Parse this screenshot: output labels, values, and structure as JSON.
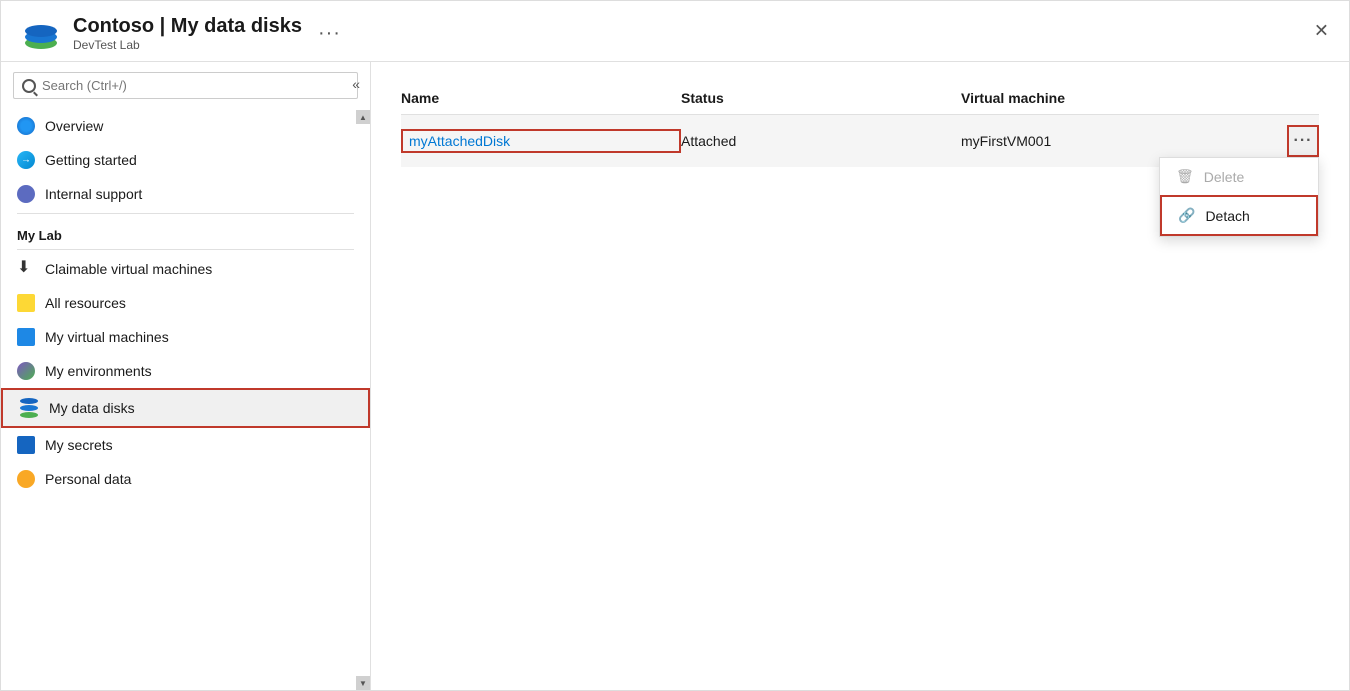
{
  "header": {
    "title": "Contoso | My data disks",
    "subtitle": "DevTest Lab",
    "dots_label": "···",
    "close_label": "✕"
  },
  "sidebar": {
    "search_placeholder": "Search (Ctrl+/)",
    "collapse_label": "«",
    "nav_items_top": [
      {
        "id": "overview",
        "label": "Overview",
        "icon": "overview-icon"
      },
      {
        "id": "getting-started",
        "label": "Getting started",
        "icon": "getting-started-icon"
      },
      {
        "id": "internal-support",
        "label": "Internal support",
        "icon": "internal-support-icon"
      }
    ],
    "my_lab_label": "My Lab",
    "nav_items_lab": [
      {
        "id": "claimable-vms",
        "label": "Claimable virtual machines",
        "icon": "claimable-icon"
      },
      {
        "id": "all-resources",
        "label": "All resources",
        "icon": "all-resources-icon"
      },
      {
        "id": "my-vms",
        "label": "My virtual machines",
        "icon": "vms-icon"
      },
      {
        "id": "my-environments",
        "label": "My environments",
        "icon": "environments-icon"
      },
      {
        "id": "my-data-disks",
        "label": "My data disks",
        "icon": "data-disks-icon",
        "active": true
      },
      {
        "id": "my-secrets",
        "label": "My secrets",
        "icon": "secrets-icon"
      },
      {
        "id": "personal-data",
        "label": "Personal data",
        "icon": "personal-data-icon"
      }
    ]
  },
  "table": {
    "columns": [
      "Name",
      "Status",
      "Virtual machine"
    ],
    "rows": [
      {
        "name": "myAttachedDisk",
        "status": "Attached",
        "vm": "myFirstVM001"
      }
    ]
  },
  "context_menu": {
    "items": [
      {
        "id": "delete",
        "label": "Delete",
        "disabled": true
      },
      {
        "id": "detach",
        "label": "Detach",
        "disabled": false,
        "highlighted": true
      }
    ]
  }
}
